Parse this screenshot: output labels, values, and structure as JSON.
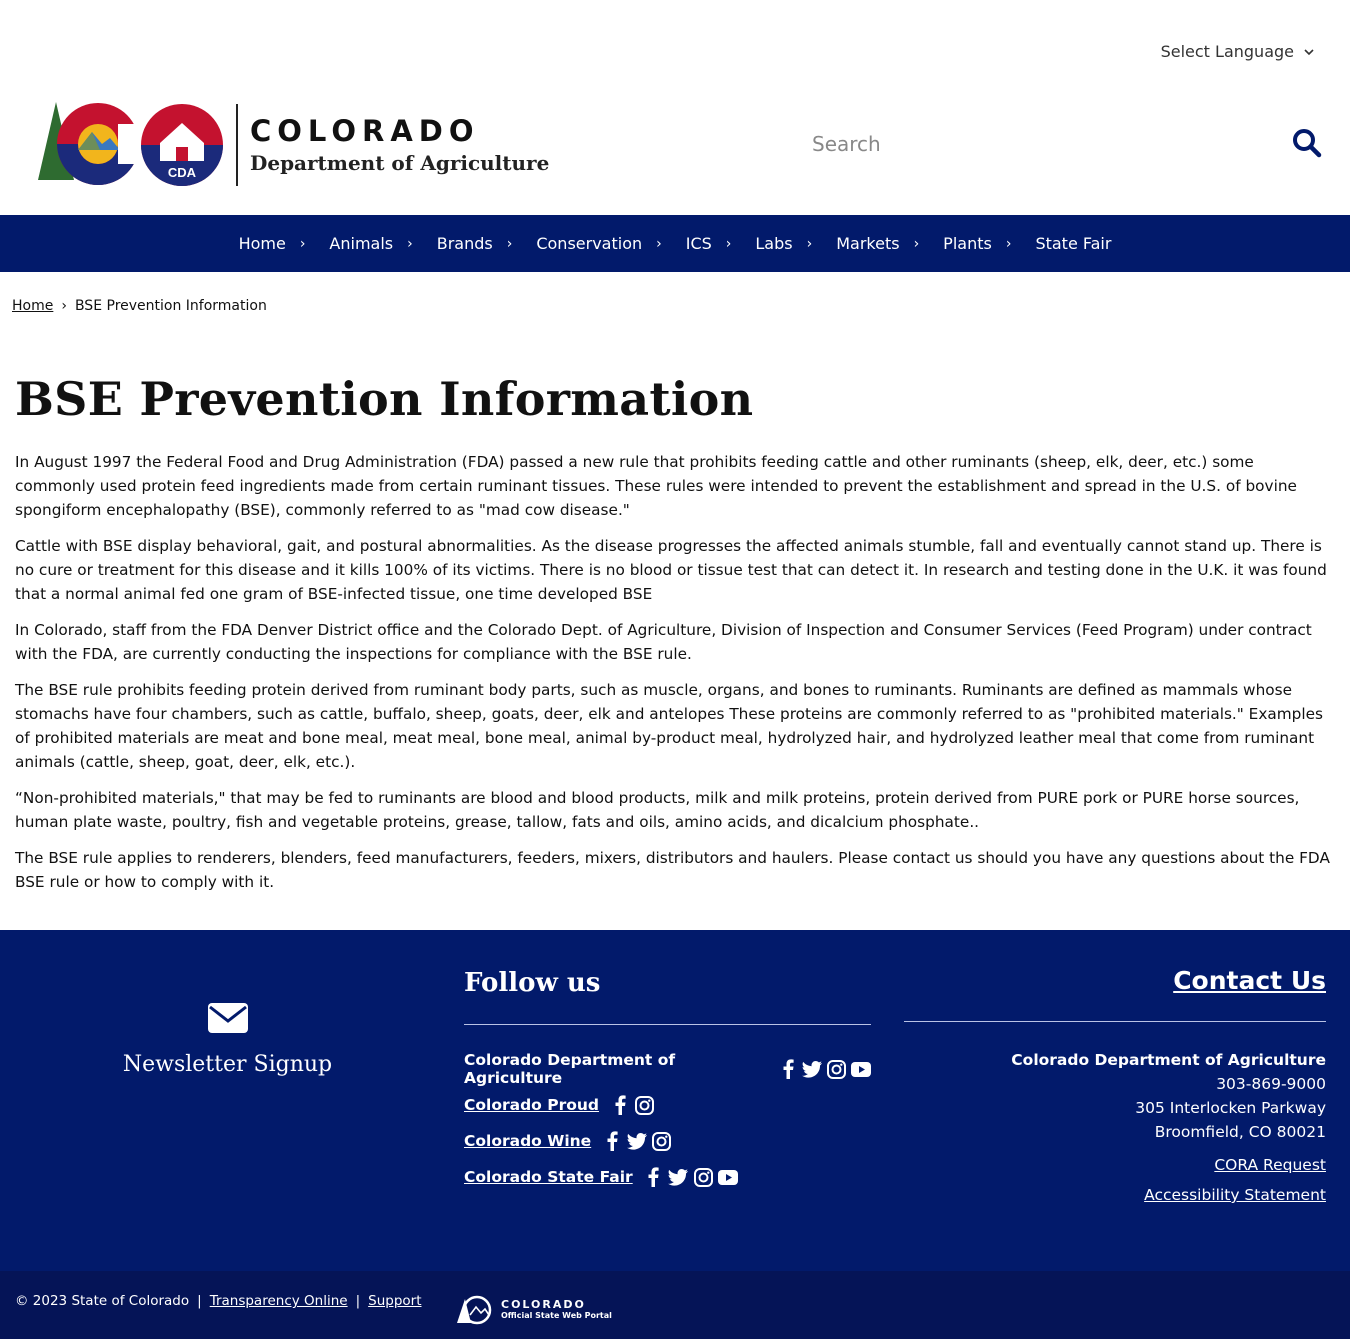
{
  "header": {
    "language_label": "Select Language",
    "search_placeholder": "Search",
    "logo": {
      "wordmark": "COLORADO",
      "department": "Department of Agriculture",
      "badge_text": "CDA"
    }
  },
  "nav": {
    "items": [
      {
        "label": "Home"
      },
      {
        "label": "Animals"
      },
      {
        "label": "Brands"
      },
      {
        "label": "Conservation"
      },
      {
        "label": "ICS"
      },
      {
        "label": "Labs"
      },
      {
        "label": "Markets"
      },
      {
        "label": "Plants"
      },
      {
        "label": "State Fair"
      }
    ]
  },
  "breadcrumb": {
    "home": "Home",
    "current": "BSE Prevention Information"
  },
  "page": {
    "title": "BSE Prevention Information",
    "paragraphs": [
      "In August 1997 the Federal Food and Drug Administration (FDA) passed a new rule that prohibits feeding cattle and other ruminants (sheep, elk, deer, etc.) some commonly used protein feed ingredients made from certain ruminant tissues. These rules were intended to prevent the establishment and spread in the U.S. of bovine spongiform encephalopathy (BSE), commonly referred to as \"mad cow disease.\"",
      "Cattle with BSE display behavioral, gait, and postural abnormalities. As the disease progresses the affected animals stumble, fall and eventually cannot stand up. There is no cure or treatment for this disease and it kills 100% of its victims. There is no blood or tissue test that can detect it. In research and testing done in the U.K. it was found that a normal animal fed one gram of BSE-infected tissue, one time developed BSE",
      "In Colorado, staff from the FDA Denver District office and the Colorado Dept. of Agriculture, Division of Inspection and Consumer Services (Feed Program) under contract with the FDA, are currently conducting the inspections for compliance with the BSE rule.",
      "The BSE rule prohibits feeding protein derived from ruminant body parts, such as muscle, organs, and bones to ruminants. Ruminants are defined as mammals whose stomachs have four chambers, such as cattle, buffalo, sheep, goats, deer, elk and antelopes These proteins are commonly referred to as \"prohibited materials.\" Examples of prohibited materials are meat and bone meal, meat meal, bone meal, animal by-product meal, hydrolyzed hair, and hydrolyzed leather meal that come from ruminant animals (cattle, sheep, goat, deer, elk, etc.).",
      "“Non-prohibited materials,\" that may be fed to ruminants are blood and blood products, milk and milk proteins, protein derived from PURE pork or PURE horse sources, human plate waste, poultry, fish and vegetable proteins, grease, tallow, fats and oils, amino acids, and dicalcium phosphate..",
      "The BSE rule applies to renderers, blenders, feed manufacturers, feeders, mixers, distributors and haulers. Please contact us should you have any questions about the FDA BSE rule or how to comply with it."
    ]
  },
  "footer": {
    "newsletter_label": "Newsletter Signup",
    "follow_title": "Follow us",
    "social": [
      {
        "name": "Colorado Department of Agriculture",
        "icons": [
          "facebook-icon",
          "twitter-icon",
          "instagram-icon",
          "youtube-icon"
        ],
        "linked": false
      },
      {
        "name": "Colorado Proud",
        "icons": [
          "facebook-icon",
          "instagram-icon"
        ],
        "linked": true
      },
      {
        "name": "Colorado Wine",
        "icons": [
          "facebook-icon",
          "twitter-icon",
          "instagram-icon"
        ],
        "linked": true
      },
      {
        "name": "Colorado State Fair",
        "icons": [
          "facebook-icon",
          "twitter-icon",
          "instagram-icon",
          "youtube-icon"
        ],
        "linked": true
      }
    ],
    "contact": {
      "title": "Contact Us",
      "org": "Colorado Department of Agriculture",
      "phone": "303-869-9000",
      "street": "305 Interlocken Parkway",
      "city": "Broomfield, CO 80021",
      "cora": "CORA Request",
      "accessibility": "Accessibility Statement"
    },
    "bottom": {
      "copyright": "© 2023 State of Colorado",
      "sep": "|",
      "transparency": "Transparency Online",
      "support": "Support",
      "portal_title": "COLORADO",
      "portal_sub": "Official State Web Portal"
    }
  },
  "colors": {
    "nav_bg": "#021a6b",
    "footer_bg": "#021a6b",
    "bottom_bg": "#051457",
    "logo_red": "#c4122f",
    "logo_blue": "#1b2a7b",
    "logo_gold": "#f2b51c",
    "tree_green": "#2e6b30"
  }
}
